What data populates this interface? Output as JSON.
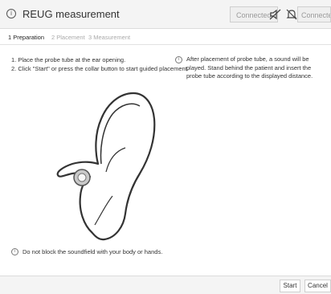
{
  "window": {
    "title": "REUG measurement"
  },
  "status": {
    "connected_1": "Connected",
    "connected_2": "Connected"
  },
  "icons": {
    "title": "info-icon",
    "mute_1": "speaker-off-icon",
    "mute_2": "bell-off-icon"
  },
  "tabs": [
    {
      "label": "1 Preparation",
      "active": true
    },
    {
      "label": "2 Placement",
      "active": false
    },
    {
      "label": "3 Measurement",
      "active": false
    }
  ],
  "instructions": {
    "step1": "1. Place the probe tube at the ear opening.",
    "step2": "2. Click \"Start\" or press the collar button to start guided placement."
  },
  "info": {
    "right": "After placement of probe tube, a sound will be played. Stand behind the patient and insert the probe tube according to the displayed distance.",
    "bottom": "Do not block the soundfield with your body or hands."
  },
  "footer": {
    "start": "Start",
    "cancel": "Cancel"
  }
}
